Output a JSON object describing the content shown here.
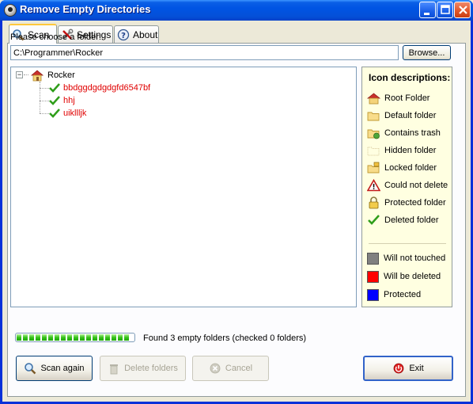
{
  "window": {
    "title": "Remove Empty Directories"
  },
  "tabs": [
    {
      "label": "Scan",
      "icon": "magnifier-icon",
      "active": true
    },
    {
      "label": "Settings",
      "icon": "tools-icon",
      "active": false
    },
    {
      "label": "About",
      "icon": "help-icon",
      "active": false
    }
  ],
  "scan": {
    "choose_label": "Please choose a folder:",
    "path_value": "C:\\Programmer\\Rocker",
    "browse_label": "Browse..."
  },
  "tree": {
    "root": {
      "label": "Rocker",
      "icon": "home-folder-icon"
    },
    "children": [
      {
        "label": "bbdggdgdgdgfd6547bf",
        "icon": "checkmark-icon",
        "status": "deleted"
      },
      {
        "label": "hhj",
        "icon": "checkmark-icon",
        "status": "deleted"
      },
      {
        "label": "uikllljk",
        "icon": "checkmark-icon",
        "status": "deleted"
      }
    ]
  },
  "legend": {
    "title": "Icon descriptions:",
    "items": [
      {
        "label": "Root Folder",
        "icon": "home-folder-icon"
      },
      {
        "label": "Default folder",
        "icon": "folder-icon"
      },
      {
        "label": "Contains trash",
        "icon": "folder-trash-icon"
      },
      {
        "label": "Hidden folder",
        "icon": "hidden-folder-icon"
      },
      {
        "label": "Locked folder",
        "icon": "locked-folder-icon"
      },
      {
        "label": "Could not delete",
        "icon": "warning-icon"
      },
      {
        "label": "Protected folder",
        "icon": "padlock-icon"
      },
      {
        "label": "Deleted folder",
        "icon": "checkmark-icon"
      }
    ],
    "colors": [
      {
        "label": "Will not touched",
        "color": "#808080"
      },
      {
        "label": "Will be deleted",
        "color": "#ff0000"
      },
      {
        "label": "Protected",
        "color": "#0000ff"
      }
    ]
  },
  "status": {
    "progress_fraction": 1.0,
    "text": "Found 3 empty folders (checked 0 folders)"
  },
  "buttons": {
    "scan_again": "Scan again",
    "delete_folders": "Delete folders",
    "cancel": "Cancel",
    "exit": "Exit"
  }
}
